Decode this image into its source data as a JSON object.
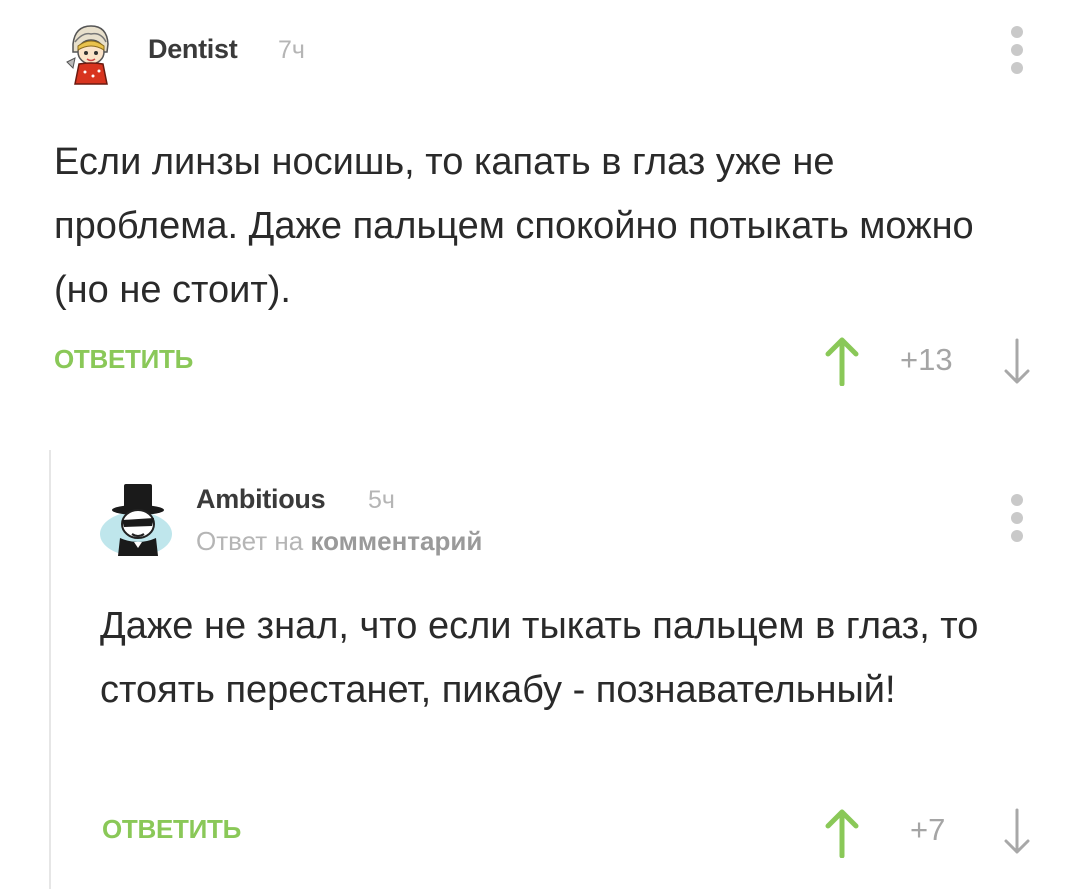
{
  "comments": [
    {
      "username": "Dentist",
      "time": "7ч",
      "text": "Если линзы носишь, то капать в глаз уже не проблема. Даже пальцем спокойно потыкать можно (но не стоит).",
      "reply_label": "ОТВЕТИТЬ",
      "score": "+13",
      "avatar_icon": "girl-with-headscarf-icon"
    },
    {
      "username": "Ambitious",
      "time": "5ч",
      "reply_to_prefix": "Ответ на",
      "reply_to_link": "комментарий",
      "text": "Даже не знал, что если тыкать пальцем в глаз, то стоять перестанет, пикабу - познавательный!",
      "reply_label": "ОТВЕТИТЬ",
      "score": "+7",
      "avatar_icon": "top-hat-gentleman-icon"
    }
  ],
  "colors": {
    "accent_green": "#8ac858",
    "muted_gray": "#b5b5b5",
    "text": "#2a2a2a"
  }
}
